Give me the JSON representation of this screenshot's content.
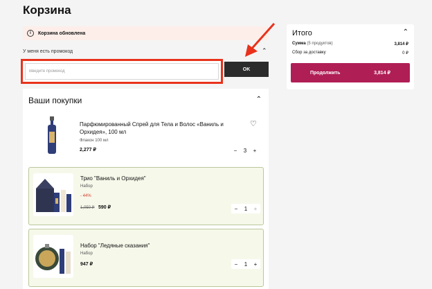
{
  "page": {
    "title": "Корзина"
  },
  "notice": {
    "text": "Корзина обновлена"
  },
  "promo": {
    "label": "У меня есть промокод",
    "placeholder": "Введите промокод",
    "button": "OK"
  },
  "cart": {
    "title": "Ваши покупки",
    "items": [
      {
        "name": "Парфюмированный Спрей для Тела и Волос «Ваниль и Орхидея», 100 мл",
        "sub": "Флакон 100 мл",
        "price": "2,277 ₽",
        "qty": "3"
      },
      {
        "name": "Трио \"Ваниль и Орхидея\"",
        "sub": "Набор",
        "discount": "- 44%",
        "old_price": "1,050 ₽",
        "price": "590 ₽",
        "qty": "1"
      },
      {
        "name": "Набор \"Ледяные сказания\"",
        "sub": "Набор",
        "price": "947 ₽",
        "qty": "1"
      }
    ]
  },
  "summary": {
    "title": "Итого",
    "sum_label": "Сумма",
    "sum_count": "(5 продуктов)",
    "sum_value": "3,814 ₽",
    "delivery_label": "Сбор за доставку",
    "delivery_value": "0 ₽",
    "continue_label": "Продолжить",
    "continue_value": "3,814 ₽"
  },
  "colors": {
    "accent": "#b01e56",
    "highlight": "#e8321c",
    "notice_bg": "#fdeee9",
    "item_bg": "#f6f8ea"
  }
}
